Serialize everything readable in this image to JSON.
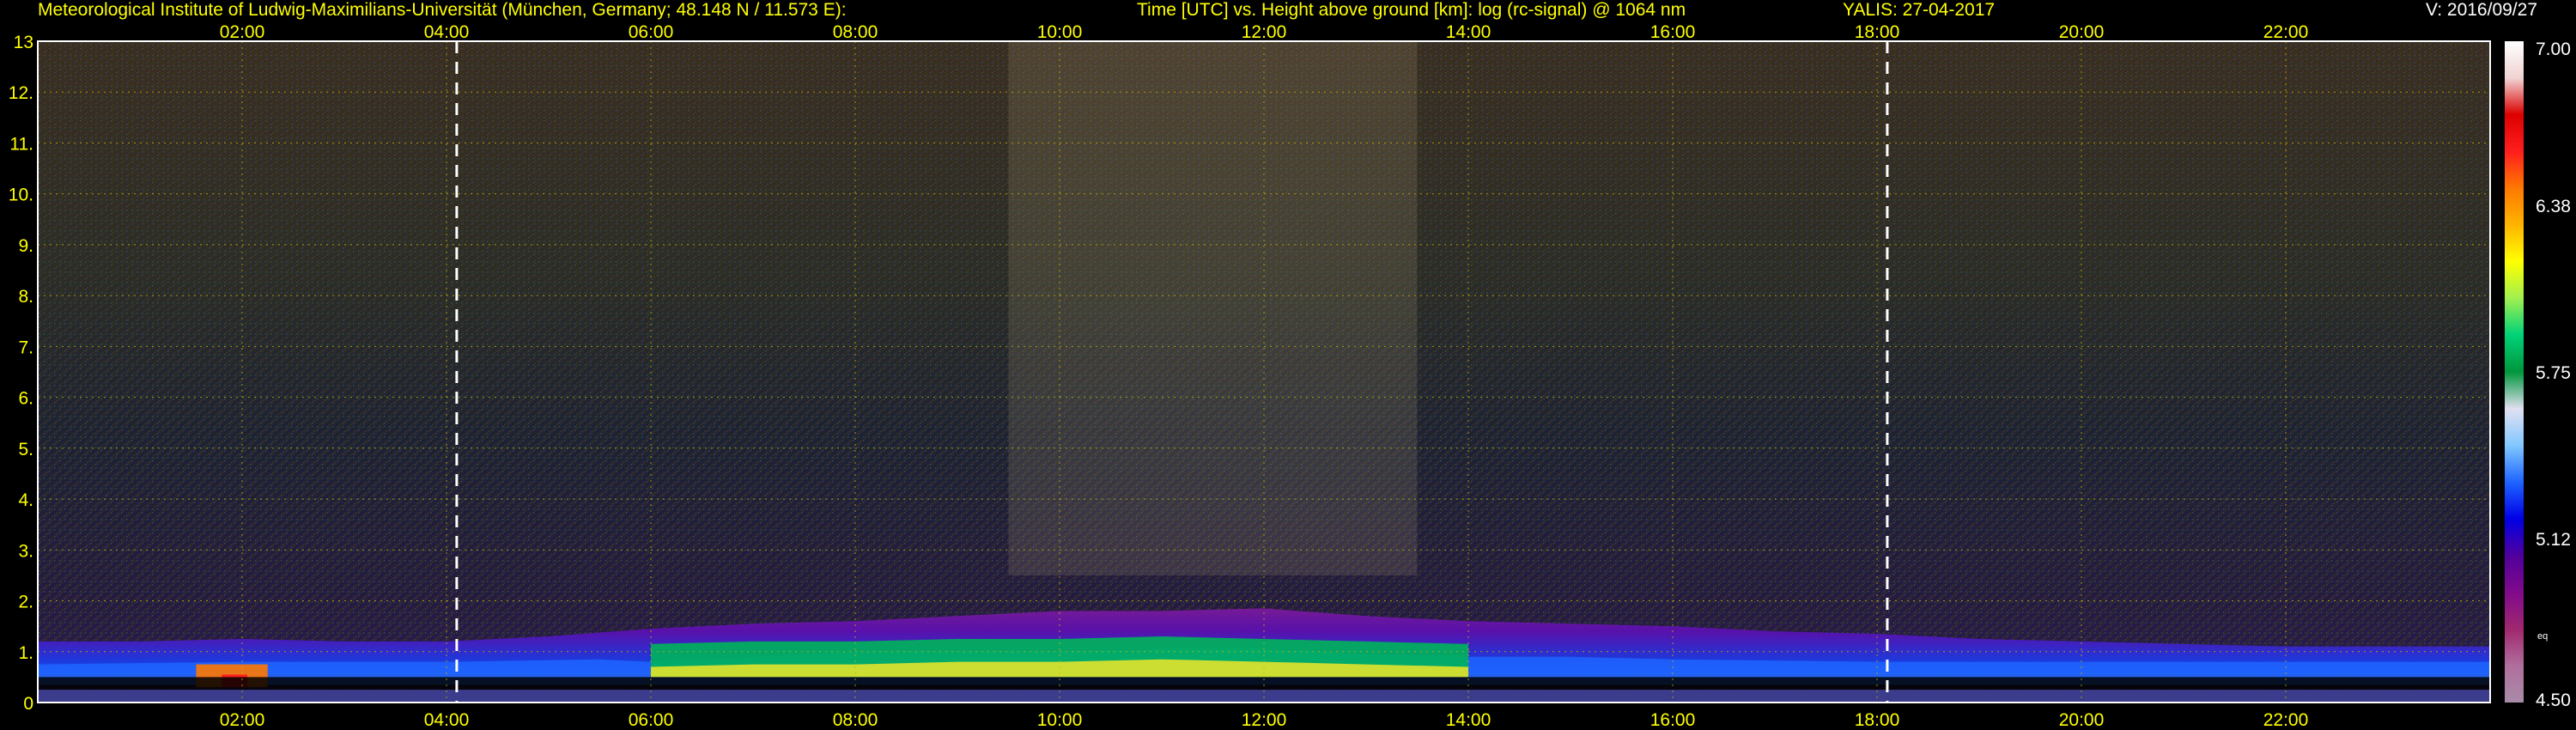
{
  "header": {
    "institute": "Meteorological Institute of Ludwig-Maximilians-Universität (München, Germany; 48.148 N / 11.573 E):",
    "axes_desc": "Time [UTC] vs. Height above ground [km]: log (rc-signal) @ 1064 nm",
    "instrument_date": "YALIS: 27-04-2017",
    "version": "V: 2016/09/27"
  },
  "colors": {
    "header_text": "#ffff00",
    "tick_text": "#ffff00",
    "grid": "#c8b400",
    "marker_lines": "#ffffff",
    "background": "#000000"
  },
  "chart_data": {
    "type": "heatmap",
    "title": "Time [UTC] vs. Height above ground [km]: log (rc-signal) @ 1064 nm",
    "x_unit": "hours UTC",
    "y_unit": "km",
    "xlim": [
      0,
      24
    ],
    "ylim": [
      0,
      13
    ],
    "x_ticks": [
      {
        "value": 2,
        "label": "02:00"
      },
      {
        "value": 4,
        "label": "04:00"
      },
      {
        "value": 6,
        "label": "06:00"
      },
      {
        "value": 8,
        "label": "08:00"
      },
      {
        "value": 10,
        "label": "10:00"
      },
      {
        "value": 12,
        "label": "12:00"
      },
      {
        "value": 14,
        "label": "14:00"
      },
      {
        "value": 16,
        "label": "16:00"
      },
      {
        "value": 18,
        "label": "18:00"
      },
      {
        "value": 20,
        "label": "20:00"
      },
      {
        "value": 22,
        "label": "22:00"
      }
    ],
    "y_ticks": [
      {
        "value": 0,
        "label": "0"
      },
      {
        "value": 1,
        "label": "1."
      },
      {
        "value": 2,
        "label": "2."
      },
      {
        "value": 3,
        "label": "3."
      },
      {
        "value": 4,
        "label": "4."
      },
      {
        "value": 5,
        "label": "5."
      },
      {
        "value": 6,
        "label": "6."
      },
      {
        "value": 7,
        "label": "7."
      },
      {
        "value": 8,
        "label": "8."
      },
      {
        "value": 9,
        "label": "9."
      },
      {
        "value": 10,
        "label": "10."
      },
      {
        "value": 11,
        "label": "11."
      },
      {
        "value": 12,
        "label": "12."
      },
      {
        "value": 13,
        "label": "13"
      }
    ],
    "marker_lines_x": [
      4.1,
      18.1
    ],
    "grid": true,
    "colorbar": {
      "min": 4.5,
      "max": 7.0,
      "ticks": [
        {
          "value": 7.0,
          "label": "7.00"
        },
        {
          "value": 6.38,
          "label": "6.38"
        },
        {
          "value": 5.75,
          "label": "5.75"
        },
        {
          "value": 5.12,
          "label": "5.12"
        },
        {
          "value": 4.5,
          "label": "4.50"
        }
      ],
      "small_label": "eq",
      "stops": [
        "#a88ca8",
        "#b06e9c",
        "#a0286e",
        "#800a8c",
        "#50009c",
        "#0000e6",
        "#1e64ff",
        "#82c8ff",
        "#e0e0f0",
        "#00963c",
        "#00d278",
        "#a0f050",
        "#ffff00",
        "#ffb400",
        "#ff7800",
        "#ff1e1e",
        "#dc0000",
        "#f0d2d2",
        "#ffffff"
      ]
    },
    "boundary_layer_top_km": [
      {
        "t": 0.0,
        "h": 1.2
      },
      {
        "t": 1.0,
        "h": 1.2
      },
      {
        "t": 2.0,
        "h": 1.25
      },
      {
        "t": 3.0,
        "h": 1.2
      },
      {
        "t": 4.0,
        "h": 1.2
      },
      {
        "t": 5.0,
        "h": 1.3
      },
      {
        "t": 6.0,
        "h": 1.45
      },
      {
        "t": 7.0,
        "h": 1.55
      },
      {
        "t": 8.0,
        "h": 1.6
      },
      {
        "t": 9.0,
        "h": 1.7
      },
      {
        "t": 10.0,
        "h": 1.8
      },
      {
        "t": 11.0,
        "h": 1.8
      },
      {
        "t": 12.0,
        "h": 1.85
      },
      {
        "t": 13.0,
        "h": 1.7
      },
      {
        "t": 14.0,
        "h": 1.6
      },
      {
        "t": 15.0,
        "h": 1.55
      },
      {
        "t": 16.0,
        "h": 1.5
      },
      {
        "t": 17.0,
        "h": 1.4
      },
      {
        "t": 18.0,
        "h": 1.35
      },
      {
        "t": 19.0,
        "h": 1.25
      },
      {
        "t": 20.0,
        "h": 1.2
      },
      {
        "t": 21.0,
        "h": 1.15
      },
      {
        "t": 22.0,
        "h": 1.1
      },
      {
        "t": 23.0,
        "h": 1.1
      },
      {
        "t": 24.0,
        "h": 1.1
      }
    ],
    "residual_layer_km": [
      {
        "t": 0.0,
        "h": 0.75
      },
      {
        "t": 2.0,
        "h": 0.8
      },
      {
        "t": 4.0,
        "h": 0.8
      },
      {
        "t": 5.5,
        "h": 0.85
      },
      {
        "t": 6.0,
        "h": 0.8
      },
      {
        "t": 7.0,
        "h": 0.9
      },
      {
        "t": 8.0,
        "h": 1.0
      },
      {
        "t": 9.0,
        "h": 1.0
      },
      {
        "t": 10.0,
        "h": 1.0
      },
      {
        "t": 11.0,
        "h": 1.05
      },
      {
        "t": 12.0,
        "h": 1.05
      },
      {
        "t": 13.0,
        "h": 0.95
      },
      {
        "t": 14.0,
        "h": 0.9
      },
      {
        "t": 15.0,
        "h": 0.9
      },
      {
        "t": 16.0,
        "h": 0.85
      },
      {
        "t": 18.0,
        "h": 0.8
      },
      {
        "t": 20.0,
        "h": 0.8
      },
      {
        "t": 22.0,
        "h": 0.8
      },
      {
        "t": 24.0,
        "h": 0.8
      }
    ],
    "aerosol_core_km": [
      {
        "t": 6.0,
        "h": 0.7
      },
      {
        "t": 7.0,
        "h": 0.75
      },
      {
        "t": 8.0,
        "h": 0.75
      },
      {
        "t": 9.0,
        "h": 0.8
      },
      {
        "t": 10.0,
        "h": 0.8
      },
      {
        "t": 11.0,
        "h": 0.85
      },
      {
        "t": 12.0,
        "h": 0.8
      },
      {
        "t": 13.0,
        "h": 0.75
      },
      {
        "t": 14.0,
        "h": 0.7
      }
    ]
  }
}
